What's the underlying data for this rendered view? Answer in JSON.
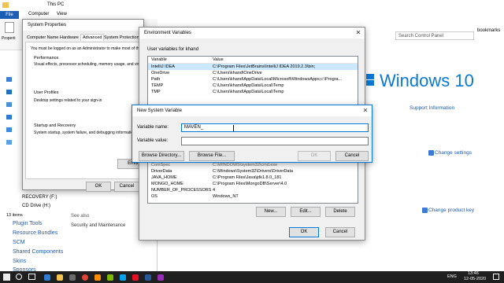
{
  "explorer": {
    "title_path": "This PC",
    "menu": [
      "File",
      "Computer",
      "View"
    ],
    "left_labels": [
      "Properti"
    ],
    "drives": [
      "RECOVERY (F:)",
      "CD Drive (H:)"
    ],
    "status_items": "13 items"
  },
  "control_panel": {
    "search_placeholder": "Search Control Panel",
    "bookmarks": "bookmarks",
    "brand": "Windows 10",
    "support_link": "Support Information",
    "change_settings": "Change settings",
    "change_product_key": "Change product key",
    "see_also": "See also",
    "security_link": "Security and Maintenance",
    "nav_items": [
      "Plugin Tools",
      "Resource Bundles",
      "SCM",
      "Shared Components",
      "Skins",
      "Sponsors"
    ]
  },
  "system_properties": {
    "title": "System Properties",
    "tabs": [
      "Computer Name",
      "Hardware",
      "Advanced",
      "System Protection"
    ],
    "admin_note": "You must be logged on as an Administrator to make most of th",
    "performance": {
      "title": "Performance",
      "text": "Visual effects, processor scheduling, memory usage, and virt"
    },
    "user_profiles": {
      "title": "User Profiles",
      "text": "Desktop settings related to your sign-in"
    },
    "startup": {
      "title": "Startup and Recovery",
      "text": "System startup, system failure, and debugging informatio"
    },
    "env_button": "Envir",
    "ok": "OK",
    "cancel": "Cancel"
  },
  "env_vars": {
    "title": "Environment Variables",
    "user_section": "User variables for khand",
    "columns": [
      "Variable",
      "Value"
    ],
    "user_rows": [
      {
        "variable": "IntelliJ IDEA",
        "value": "C:\\Program Files\\JetBrains\\IntelliJ IDEA 2019.2.3\\bin;"
      },
      {
        "variable": "OneDrive",
        "value": "C:\\Users\\khand\\OneDrive"
      },
      {
        "variable": "Path",
        "value": "C:\\Users\\khand\\AppData\\Local\\Microsoft\\WindowsApps;c:\\Progra..."
      },
      {
        "variable": "TEMP",
        "value": "C:\\Users\\khand\\AppData\\Local\\Temp"
      },
      {
        "variable": "TMP",
        "value": "C:\\Users\\khand\\AppData\\Local\\Temp"
      }
    ],
    "system_rows": [
      {
        "variable": "ComSpec",
        "value": "C:\\WINDOWS\\system32\\cmd.exe"
      },
      {
        "variable": "DriverData",
        "value": "C:\\Windows\\System32\\Drivers\\DriverData"
      },
      {
        "variable": "JAVA_HOME",
        "value": "C:\\Program Files\\Java\\jdk1.8.0_181"
      },
      {
        "variable": "MONGO_HOME",
        "value": "C:\\Program Files\\MongoDB\\Server\\4.0"
      },
      {
        "variable": "NUMBER_OF_PROCESSORS",
        "value": "4"
      },
      {
        "variable": "OS",
        "value": "Windows_NT"
      }
    ],
    "new_button": "New...",
    "edit_button": "Edit...",
    "delete_button": "Delete",
    "ok": "OK",
    "cancel": "Cancel"
  },
  "new_var": {
    "title": "New System Variable",
    "name_label": "Variable name:",
    "name_value": "MAVEN_",
    "value_label": "Variable value:",
    "value_value": "",
    "browse_dir": "Browse Directory...",
    "browse_file": "Browse File...",
    "ok": "OK",
    "cancel": "Cancel"
  },
  "taskbar": {
    "time": "13:46",
    "date": "12-05-2020",
    "lang": "ENG"
  }
}
